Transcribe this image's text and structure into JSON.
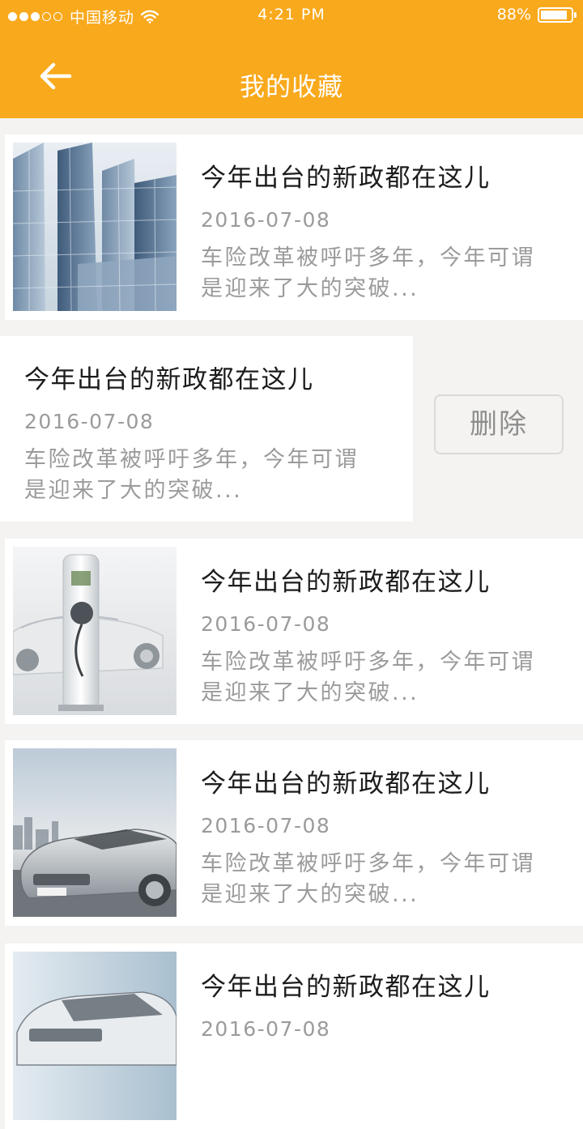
{
  "status_bar": {
    "carrier": "中国移动",
    "time": "4:21 PM",
    "battery_text": "88%",
    "battery_level": 0.88,
    "signal_bars_filled": 3,
    "signal_bars_total": 5
  },
  "header": {
    "title": "我的收藏",
    "back_icon": "arrow-left-icon",
    "background_color": "#f9a91c"
  },
  "favorites": [
    {
      "title": "今年出台的新政都在这儿",
      "date": "2016-07-08",
      "summary_line1": "车险改革被呼吁多年，今年可谓",
      "summary_line2": "是迎来了大的突破...",
      "image": "glass-skyscrapers"
    },
    {
      "title": "今年出台的新政都在这儿",
      "date": "2016-07-08",
      "summary_line1": "车险改革被呼吁多年，今年可谓",
      "summary_line2": "是迎来了大的突破...",
      "image": "none",
      "swiped_open": true
    },
    {
      "title": "今年出台的新政都在这儿",
      "date": "2016-07-08",
      "summary_line1": "车险改革被呼吁多年，今年可谓",
      "summary_line2": "是迎来了大的突破...",
      "image": "ev-charging-station"
    },
    {
      "title": "今年出台的新政都在这儿",
      "date": "2016-07-08",
      "summary_line1": "车险改革被呼吁多年，今年可谓",
      "summary_line2": "是迎来了大的突破...",
      "image": "silver-camry"
    },
    {
      "title": "今年出台的新政都在这儿",
      "date": "2016-07-08",
      "summary_line1": "",
      "summary_line2": "",
      "image": "silver-sedan"
    }
  ],
  "actions": {
    "delete_label": "删除"
  }
}
